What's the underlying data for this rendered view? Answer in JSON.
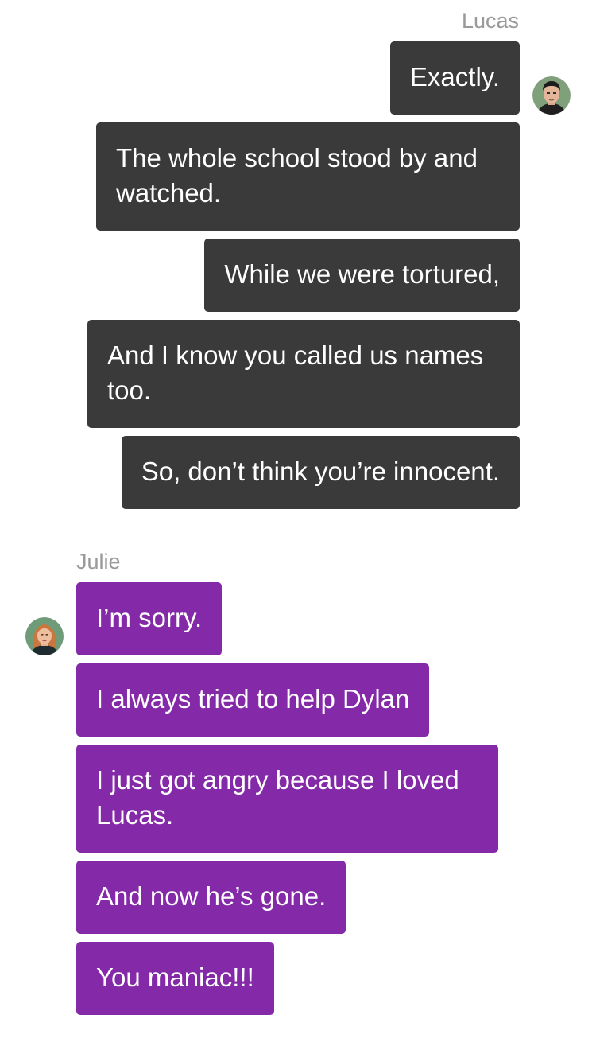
{
  "conversation": {
    "lucas": {
      "name": "Lucas",
      "avatar_icon": "male-avatar-icon",
      "bubble_color": "#3a3a3a",
      "messages": [
        "Exactly.",
        "The whole school stood by and watched.",
        "While we were tortured,",
        "And I know you called us names too.",
        "So, don’t think you’re innocent."
      ]
    },
    "julie": {
      "name": "Julie",
      "avatar_icon": "female-avatar-icon",
      "bubble_color": "#8429a8",
      "messages": [
        "I’m sorry.",
        "I always tried to help Dylan",
        "I just got angry because I loved Lucas.",
        "And now he’s gone.",
        "You maniac!!!"
      ]
    }
  }
}
